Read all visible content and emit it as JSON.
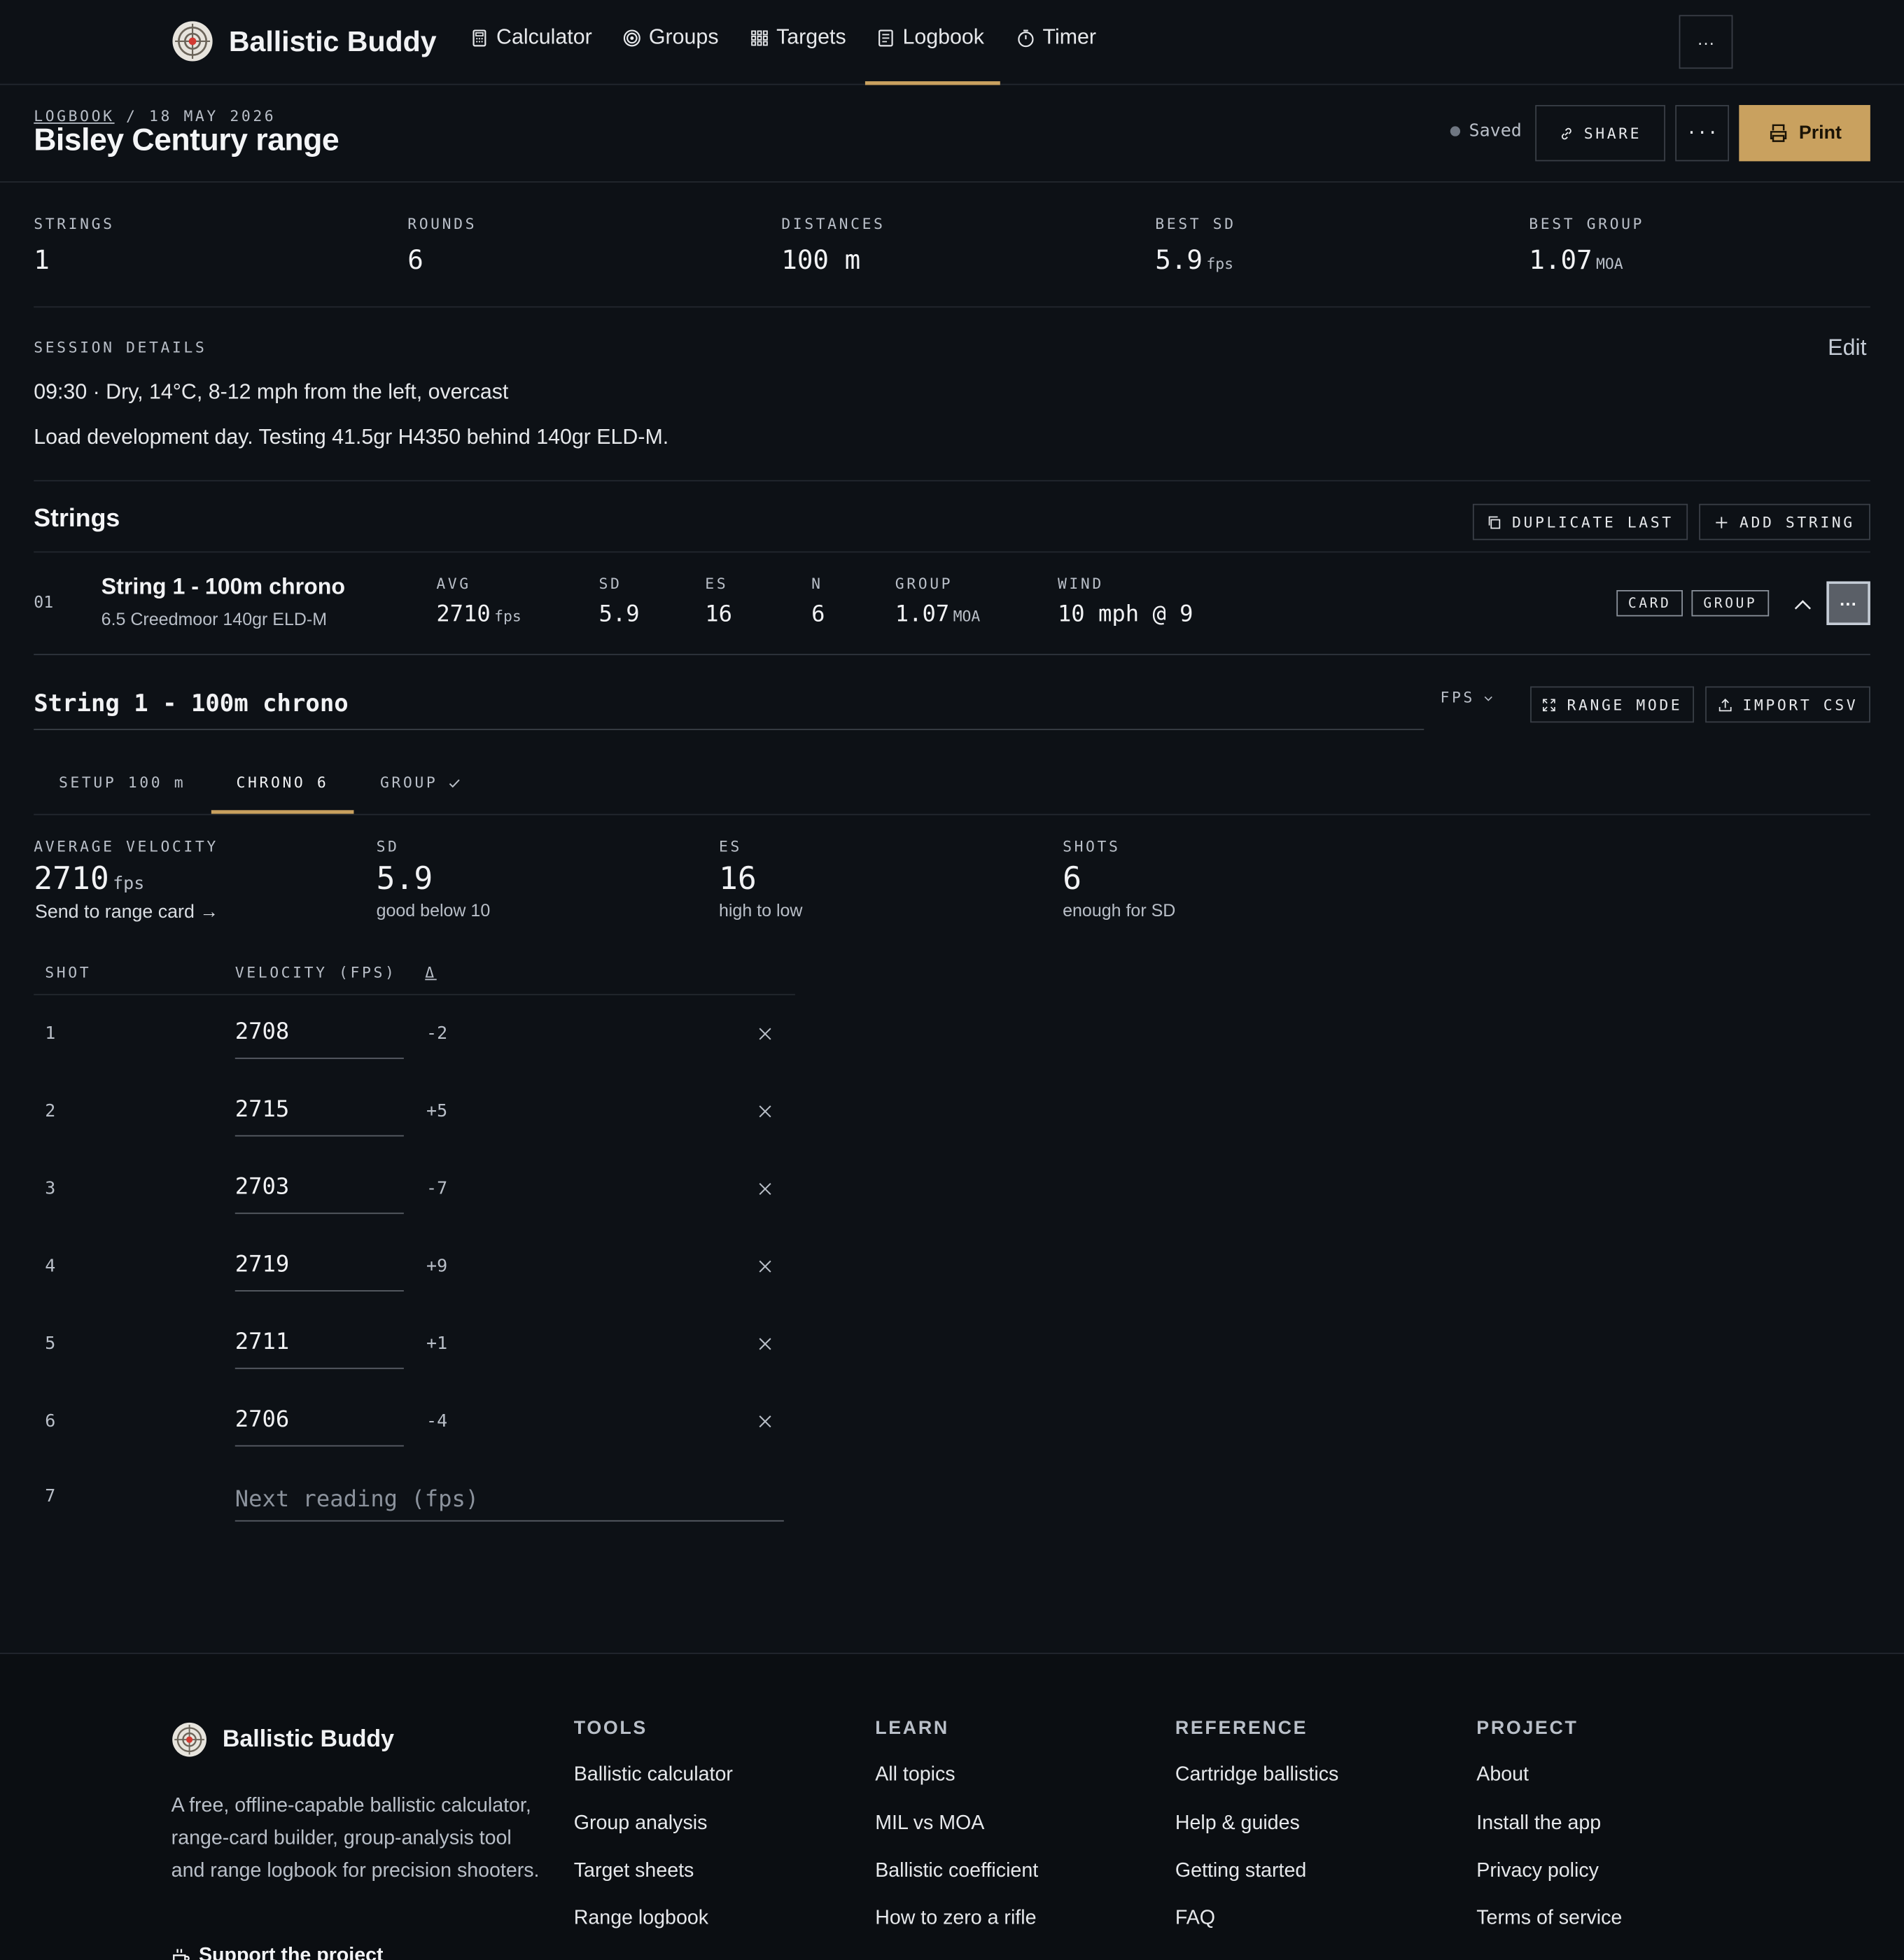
{
  "app": {
    "name": "Ballistic Buddy"
  },
  "nav": {
    "items": [
      {
        "label": "Calculator",
        "icon": "calculator-icon"
      },
      {
        "label": "Groups",
        "icon": "target-icon"
      },
      {
        "label": "Targets",
        "icon": "grid-icon"
      },
      {
        "label": "Logbook",
        "icon": "logbook-icon"
      },
      {
        "label": "Timer",
        "icon": "timer-icon"
      }
    ],
    "active": "Logbook",
    "more": "···"
  },
  "header": {
    "breadcrumb_link": "LOGBOOK",
    "breadcrumb_sep": "/",
    "breadcrumb_date": "18 MAY 2026",
    "title": "Bisley Century range",
    "saved": "Saved",
    "share": "SHARE",
    "more": "···",
    "print": "Print"
  },
  "stats": [
    {
      "label": "STRINGS",
      "value": "1",
      "unit": ""
    },
    {
      "label": "ROUNDS",
      "value": "6",
      "unit": ""
    },
    {
      "label": "DISTANCES",
      "value": "100 m",
      "unit": ""
    },
    {
      "label": "BEST SD",
      "value": "5.9",
      "unit": "fps"
    },
    {
      "label": "BEST GROUP",
      "value": "1.07",
      "unit": "MOA"
    }
  ],
  "session": {
    "label": "SESSION DETAILS",
    "edit": "Edit",
    "conditions": "09:30 · Dry, 14°C, 8-12 mph from the left, overcast",
    "notes": "Load development day. Testing 41.5gr H4350 behind 140gr ELD-M."
  },
  "strings_section": {
    "title": "Strings",
    "duplicate": "DUPLICATE LAST",
    "add": "ADD STRING"
  },
  "string_row": {
    "index": "01",
    "title": "String 1 - 100m chrono",
    "subtitle": "6.5 Creedmoor 140gr ELD-M",
    "avg_label": "AVG",
    "avg": "2710",
    "avg_unit": "fps",
    "sd_label": "SD",
    "sd": "5.9",
    "es_label": "ES",
    "es": "16",
    "n_label": "N",
    "n": "6",
    "group_label": "GROUP",
    "group": "1.07",
    "group_unit": "MOA",
    "wind_label": "WIND",
    "wind": "10 mph @ 9",
    "tag_card": "CARD",
    "tag_group": "GROUP",
    "kebab": "···"
  },
  "editor": {
    "title": "String 1 - 100m chrono",
    "unit_select": "FPS",
    "range_mode": "RANGE MODE",
    "import_csv": "IMPORT CSV",
    "tabs": [
      {
        "label": "SETUP 100 m"
      },
      {
        "label": "CHRONO 6"
      },
      {
        "label": "GROUP"
      }
    ],
    "active_tab": "CHRONO 6",
    "summary": {
      "avg_label": "AVERAGE VELOCITY",
      "avg": "2710",
      "avg_unit": "fps",
      "send": "Send to range card →",
      "sd_label": "SD",
      "sd": "5.9",
      "sd_note": "good below 10",
      "es_label": "ES",
      "es": "16",
      "es_note": "high to low",
      "shots_label": "SHOTS",
      "shots": "6",
      "shots_note": "enough for SD"
    },
    "table": {
      "col_shot": "SHOT",
      "col_velocity": "VELOCITY (FPS)",
      "col_delta": "Δ",
      "rows": [
        {
          "shot": "1",
          "velocity": "2708",
          "delta": "-2"
        },
        {
          "shot": "2",
          "velocity": "2715",
          "delta": "+5"
        },
        {
          "shot": "3",
          "velocity": "2703",
          "delta": "-7"
        },
        {
          "shot": "4",
          "velocity": "2719",
          "delta": "+9"
        },
        {
          "shot": "5",
          "velocity": "2711",
          "delta": "+1"
        },
        {
          "shot": "6",
          "velocity": "2706",
          "delta": "-4"
        }
      ],
      "next_shot": "7",
      "next_placeholder": "Next reading (fps)"
    }
  },
  "footer": {
    "brand": "Ballistic Buddy",
    "description": "A free, offline-capable ballistic calculator, range-card builder, group-analysis tool and range logbook for precision shooters.",
    "support": "Support the project",
    "columns": [
      {
        "heading": "TOOLS",
        "links": [
          "Ballistic calculator",
          "Group analysis",
          "Target sheets",
          "Range logbook"
        ]
      },
      {
        "heading": "LEARN",
        "links": [
          "All topics",
          "MIL vs MOA",
          "Ballistic coefficient",
          "How to zero a rifle"
        ]
      },
      {
        "heading": "REFERENCE",
        "links": [
          "Cartridge ballistics",
          "Help & guides",
          "Getting started",
          "FAQ"
        ]
      },
      {
        "heading": "PROJECT",
        "links": [
          "About",
          "Install the app",
          "Privacy policy",
          "Terms of service"
        ]
      }
    ]
  },
  "colors": {
    "background": "#0d1116",
    "accent": "#c9a15f",
    "border": "#3a3f47",
    "muted_text": "#b9bfc8",
    "logo_dot": "#d23a32"
  }
}
